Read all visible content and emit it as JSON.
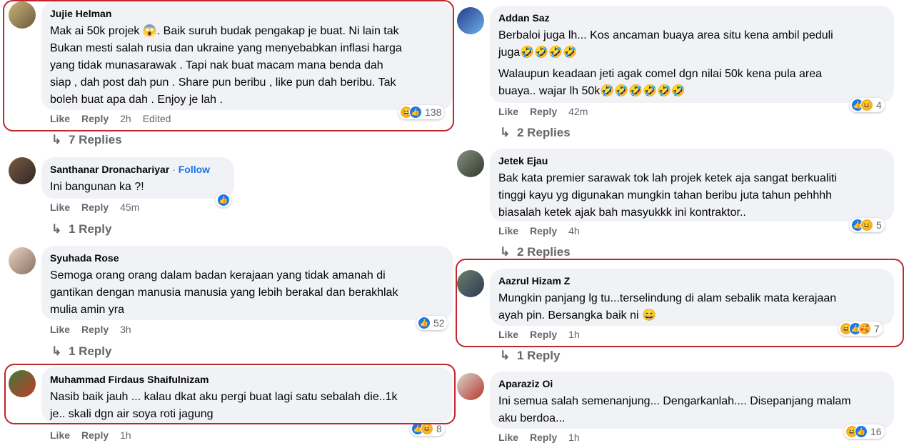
{
  "left": [
    {
      "name": "Jujie Helman",
      "text": "Mak ai 50k projek 😱. Baik suruh budak pengakap je buat. Ni lain tak\nBukan mesti salah rusia dan ukraine yang menyebabkan inflasi harga\nyang tidak munasarawak . Tapi nak buat macam mana benda dah\nsiap , dah post dah pun . Share pun beribu , like pun dah beribu. Tak\nboleh buat apa dah . Enjoy je lah .",
      "like": "Like",
      "reply": "Reply",
      "time": "2h",
      "edited": "Edited",
      "reactions": [
        "haha",
        "like"
      ],
      "count": "138",
      "replies": "7 Replies"
    },
    {
      "name": "Santhanar Dronachariyar",
      "follow": "Follow",
      "text": "Ini bangunan ka ?!",
      "like": "Like",
      "reply": "Reply",
      "time": "45m",
      "reactions": [
        "like"
      ],
      "count": "",
      "replies": "1 Reply"
    },
    {
      "name": "Syuhada Rose",
      "text": "Semoga orang orang dalam badan kerajaan yang tidak amanah di\ngantikan dengan manusia manusia yang lebih berakal dan berakhlak\nmulia amin yra",
      "like": "Like",
      "reply": "Reply",
      "time": "3h",
      "reactions": [
        "like"
      ],
      "count": "52",
      "replies": "1 Reply"
    },
    {
      "name": "Muhammad Firdaus Shaifulnizam",
      "text": "Nasib baik jauh ... kalau dkat aku pergi buat lagi satu sebalah die..1k\nje.. skali dgn air soya roti jagung",
      "like": "Like",
      "reply": "Reply",
      "time": "1h",
      "reactions": [
        "like",
        "haha"
      ],
      "count": "8"
    }
  ],
  "right": [
    {
      "name": "Addan Saz",
      "text": "Berbaloi juga lh... Kos ancaman buaya area situ kena ambil peduli\njuga🤣🤣🤣🤣",
      "text2": "Walaupun keadaan jeti agak comel dgn nilai 50k kena pula area\nbuaya.. wajar lh 50k🤣🤣🤣🤣🤣🤣",
      "like": "Like",
      "reply": "Reply",
      "time": "42m",
      "reactions": [
        "like",
        "haha"
      ],
      "count": "4",
      "replies": "2 Replies"
    },
    {
      "name": "Jetek Ejau",
      "text": "Bak kata premier sarawak tok lah projek ketek aja sangat berkualiti\ntinggi kayu yg digunakan mungkin tahan beribu juta tahun pehhhh\nbiasalah ketek ajak bah masyukkk ini kontraktor..",
      "like": "Like",
      "reply": "Reply",
      "time": "4h",
      "reactions": [
        "like",
        "haha"
      ],
      "count": "5",
      "replies": "2 Replies"
    },
    {
      "name": "Aazrul Hizam Z",
      "text": "Mungkin panjang lg tu...terselindung di alam sebalik mata kerajaan\nayah pin. Bersangka baik ni 😄",
      "like": "Like",
      "reply": "Reply",
      "time": "1h",
      "reactions": [
        "haha",
        "like",
        "care"
      ],
      "count": "7",
      "replies": "1 Reply"
    },
    {
      "name": "Aparaziz Oi",
      "text": "Ini semua salah semenanjung... Dengarkanlah.... Disepanjang malam\naku berdoa...",
      "like": "Like",
      "reply": "Reply",
      "time": "1h",
      "reactions": [
        "haha",
        "like"
      ],
      "count": "16"
    }
  ],
  "colors": {
    "highlight": "#c0262d",
    "bubble": "#f0f2f5",
    "like": "#1877f2",
    "haha": "#f7b125"
  }
}
